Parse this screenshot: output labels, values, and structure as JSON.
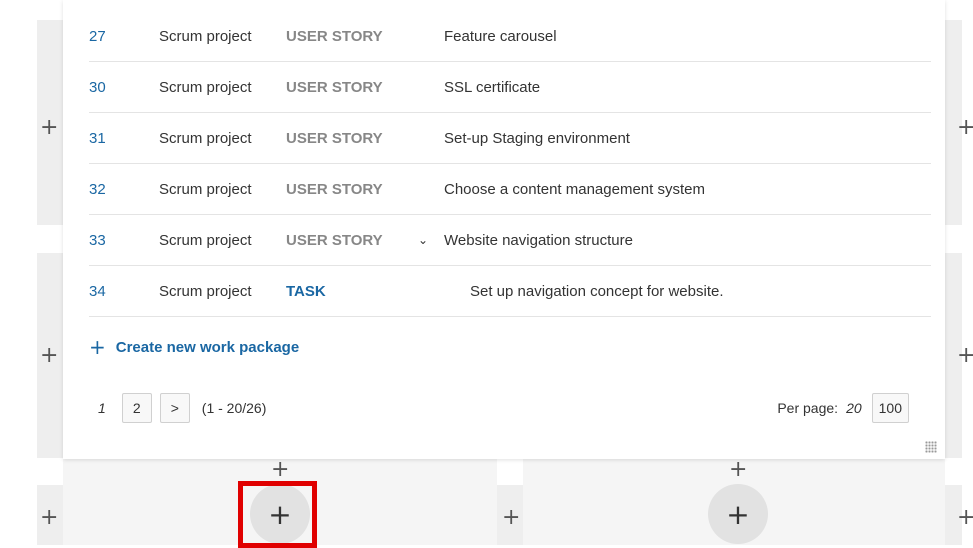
{
  "rows": [
    {
      "id": "27",
      "project": "Scrum project",
      "type": "USER STORY",
      "subject": "Feature carousel"
    },
    {
      "id": "30",
      "project": "Scrum project",
      "type": "USER STORY",
      "subject": "SSL certificate"
    },
    {
      "id": "31",
      "project": "Scrum project",
      "type": "USER STORY",
      "subject": "Set-up Staging environment"
    },
    {
      "id": "32",
      "project": "Scrum project",
      "type": "USER STORY",
      "subject": "Choose a content management system"
    },
    {
      "id": "33",
      "project": "Scrum project",
      "type": "USER STORY",
      "subject": "Website navigation structure",
      "expand_icon": "chevron-down-icon",
      "expand_glyph": "⌄"
    },
    {
      "id": "34",
      "project": "Scrum project",
      "type": "TASK",
      "subject": "Set up navigation concept for website."
    }
  ],
  "create_label": "Create new work package",
  "plus_glyph": "+",
  "pagination": {
    "current": "1",
    "page2": "2",
    "next": ">",
    "range": "(1 - 20/26)"
  },
  "per_page": {
    "label": "Per page:",
    "current": "20",
    "option": "100"
  },
  "colors": {
    "link": "#1a67a3",
    "type_gray": "#878787",
    "highlight": "#e00000"
  }
}
